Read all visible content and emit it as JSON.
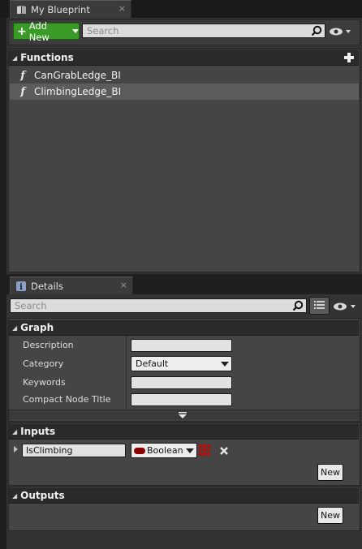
{
  "my_blueprint_tab": {
    "title": "My Blueprint",
    "close": "×"
  },
  "toolbar": {
    "add_new_label": "Add New",
    "search_placeholder": "Search"
  },
  "functions": {
    "header": "Functions",
    "items": [
      {
        "label": "CanGrabLedge_BI",
        "selected": false
      },
      {
        "label": "ClimbingLedge_BI",
        "selected": true
      }
    ]
  },
  "details_tab": {
    "title": "Details",
    "close": "×"
  },
  "details": {
    "search_placeholder": "Search",
    "graph": {
      "header": "Graph",
      "description_label": "Description",
      "description_value": "",
      "category_label": "Category",
      "category_value": "Default",
      "keywords_label": "Keywords",
      "keywords_value": "",
      "compact_node_title_label": "Compact Node Title",
      "compact_node_title_value": ""
    },
    "inputs": {
      "header": "Inputs",
      "params": [
        {
          "name": "IsClimbing",
          "type": "Boolean"
        }
      ],
      "new_label": "New"
    },
    "outputs": {
      "header": "Outputs",
      "new_label": "New"
    }
  },
  "colors": {
    "add_new_green": "#3a9a26",
    "boolean_pin": "#8c0000",
    "selected_row": "#5c5c5c",
    "panel_bg": "#454545"
  },
  "icons": [
    "book-icon",
    "plus-icon",
    "search-icon",
    "eye-icon",
    "function-icon",
    "info-icon",
    "grid-view-icon",
    "pin-type-icon",
    "container-grid-icon",
    "remove-icon",
    "expand-arrow-icon"
  ]
}
